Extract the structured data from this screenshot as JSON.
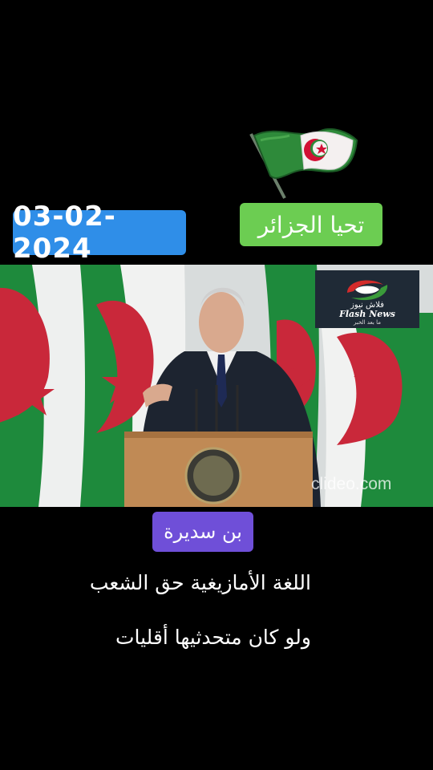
{
  "date_tag": "03-02-2024",
  "slogan_tag": "تحيا الجزائر",
  "name_tag": "بن سديرة",
  "caption": {
    "line1": "اللغة الأمازيغية حق الشعب",
    "line2": "ولو كان متحدثيها أقليات"
  },
  "video": {
    "logo": {
      "arabic": "فلاش نيوز",
      "english": "Flash News",
      "tagline": "ما بعد الخبر"
    },
    "watermark": "clideo.com"
  },
  "colors": {
    "date_tag": "#2f8ee8",
    "slogan_tag": "#6ccd52",
    "name_tag": "#6f4fd8",
    "flag_green": "#1f8a3a",
    "flag_red": "#d21034"
  },
  "icons": [
    "algerian-flag-icon",
    "flash-news-logo-icon",
    "emblem-icon"
  ]
}
